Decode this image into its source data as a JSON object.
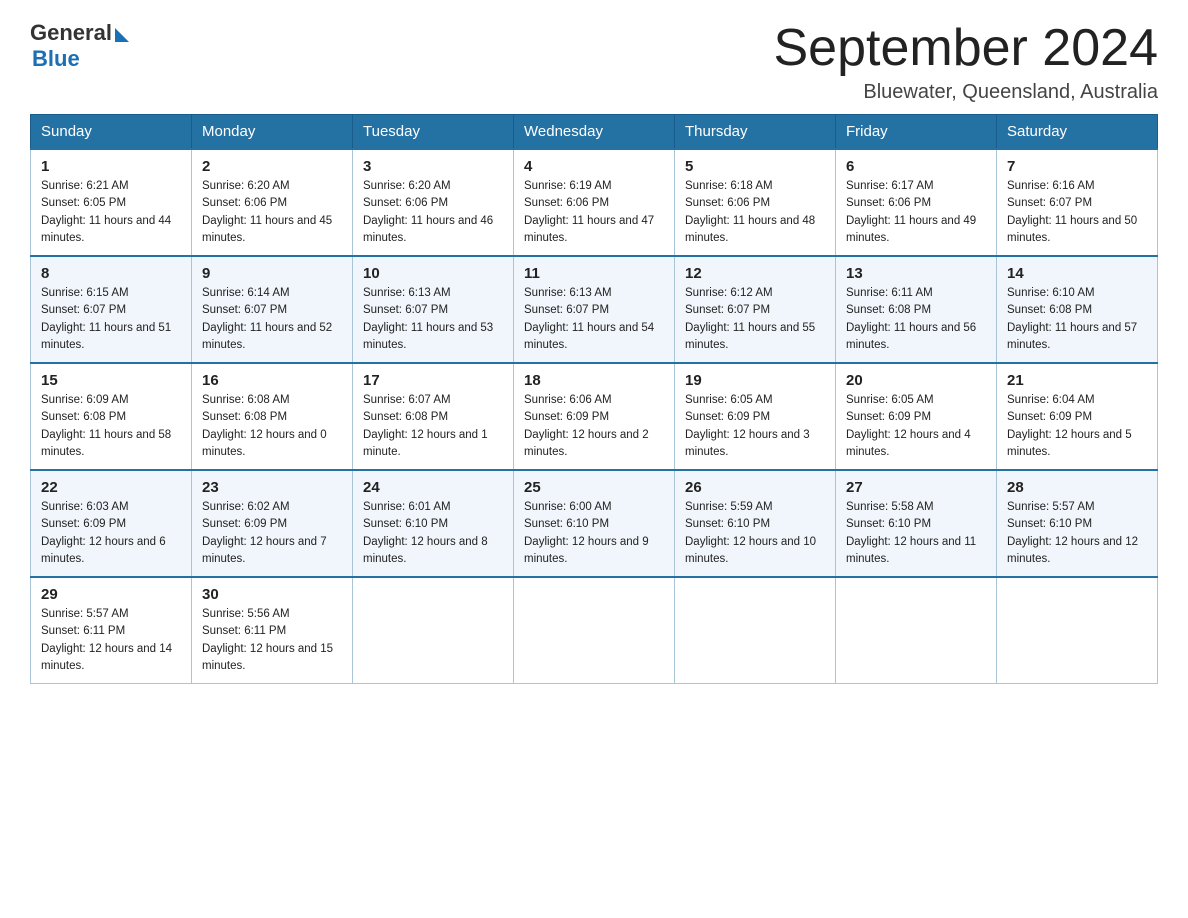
{
  "header": {
    "logo_general": "General",
    "logo_blue": "Blue",
    "month_title": "September 2024",
    "location": "Bluewater, Queensland, Australia"
  },
  "weekdays": [
    "Sunday",
    "Monday",
    "Tuesday",
    "Wednesday",
    "Thursday",
    "Friday",
    "Saturday"
  ],
  "weeks": [
    [
      {
        "day": "1",
        "sunrise": "6:21 AM",
        "sunset": "6:05 PM",
        "daylight": "11 hours and 44 minutes."
      },
      {
        "day": "2",
        "sunrise": "6:20 AM",
        "sunset": "6:06 PM",
        "daylight": "11 hours and 45 minutes."
      },
      {
        "day": "3",
        "sunrise": "6:20 AM",
        "sunset": "6:06 PM",
        "daylight": "11 hours and 46 minutes."
      },
      {
        "day": "4",
        "sunrise": "6:19 AM",
        "sunset": "6:06 PM",
        "daylight": "11 hours and 47 minutes."
      },
      {
        "day": "5",
        "sunrise": "6:18 AM",
        "sunset": "6:06 PM",
        "daylight": "11 hours and 48 minutes."
      },
      {
        "day": "6",
        "sunrise": "6:17 AM",
        "sunset": "6:06 PM",
        "daylight": "11 hours and 49 minutes."
      },
      {
        "day": "7",
        "sunrise": "6:16 AM",
        "sunset": "6:07 PM",
        "daylight": "11 hours and 50 minutes."
      }
    ],
    [
      {
        "day": "8",
        "sunrise": "6:15 AM",
        "sunset": "6:07 PM",
        "daylight": "11 hours and 51 minutes."
      },
      {
        "day": "9",
        "sunrise": "6:14 AM",
        "sunset": "6:07 PM",
        "daylight": "11 hours and 52 minutes."
      },
      {
        "day": "10",
        "sunrise": "6:13 AM",
        "sunset": "6:07 PM",
        "daylight": "11 hours and 53 minutes."
      },
      {
        "day": "11",
        "sunrise": "6:13 AM",
        "sunset": "6:07 PM",
        "daylight": "11 hours and 54 minutes."
      },
      {
        "day": "12",
        "sunrise": "6:12 AM",
        "sunset": "6:07 PM",
        "daylight": "11 hours and 55 minutes."
      },
      {
        "day": "13",
        "sunrise": "6:11 AM",
        "sunset": "6:08 PM",
        "daylight": "11 hours and 56 minutes."
      },
      {
        "day": "14",
        "sunrise": "6:10 AM",
        "sunset": "6:08 PM",
        "daylight": "11 hours and 57 minutes."
      }
    ],
    [
      {
        "day": "15",
        "sunrise": "6:09 AM",
        "sunset": "6:08 PM",
        "daylight": "11 hours and 58 minutes."
      },
      {
        "day": "16",
        "sunrise": "6:08 AM",
        "sunset": "6:08 PM",
        "daylight": "12 hours and 0 minutes."
      },
      {
        "day": "17",
        "sunrise": "6:07 AM",
        "sunset": "6:08 PM",
        "daylight": "12 hours and 1 minute."
      },
      {
        "day": "18",
        "sunrise": "6:06 AM",
        "sunset": "6:09 PM",
        "daylight": "12 hours and 2 minutes."
      },
      {
        "day": "19",
        "sunrise": "6:05 AM",
        "sunset": "6:09 PM",
        "daylight": "12 hours and 3 minutes."
      },
      {
        "day": "20",
        "sunrise": "6:05 AM",
        "sunset": "6:09 PM",
        "daylight": "12 hours and 4 minutes."
      },
      {
        "day": "21",
        "sunrise": "6:04 AM",
        "sunset": "6:09 PM",
        "daylight": "12 hours and 5 minutes."
      }
    ],
    [
      {
        "day": "22",
        "sunrise": "6:03 AM",
        "sunset": "6:09 PM",
        "daylight": "12 hours and 6 minutes."
      },
      {
        "day": "23",
        "sunrise": "6:02 AM",
        "sunset": "6:09 PM",
        "daylight": "12 hours and 7 minutes."
      },
      {
        "day": "24",
        "sunrise": "6:01 AM",
        "sunset": "6:10 PM",
        "daylight": "12 hours and 8 minutes."
      },
      {
        "day": "25",
        "sunrise": "6:00 AM",
        "sunset": "6:10 PM",
        "daylight": "12 hours and 9 minutes."
      },
      {
        "day": "26",
        "sunrise": "5:59 AM",
        "sunset": "6:10 PM",
        "daylight": "12 hours and 10 minutes."
      },
      {
        "day": "27",
        "sunrise": "5:58 AM",
        "sunset": "6:10 PM",
        "daylight": "12 hours and 11 minutes."
      },
      {
        "day": "28",
        "sunrise": "5:57 AM",
        "sunset": "6:10 PM",
        "daylight": "12 hours and 12 minutes."
      }
    ],
    [
      {
        "day": "29",
        "sunrise": "5:57 AM",
        "sunset": "6:11 PM",
        "daylight": "12 hours and 14 minutes."
      },
      {
        "day": "30",
        "sunrise": "5:56 AM",
        "sunset": "6:11 PM",
        "daylight": "12 hours and 15 minutes."
      },
      null,
      null,
      null,
      null,
      null
    ]
  ],
  "labels": {
    "sunrise": "Sunrise:",
    "sunset": "Sunset:",
    "daylight": "Daylight:"
  }
}
